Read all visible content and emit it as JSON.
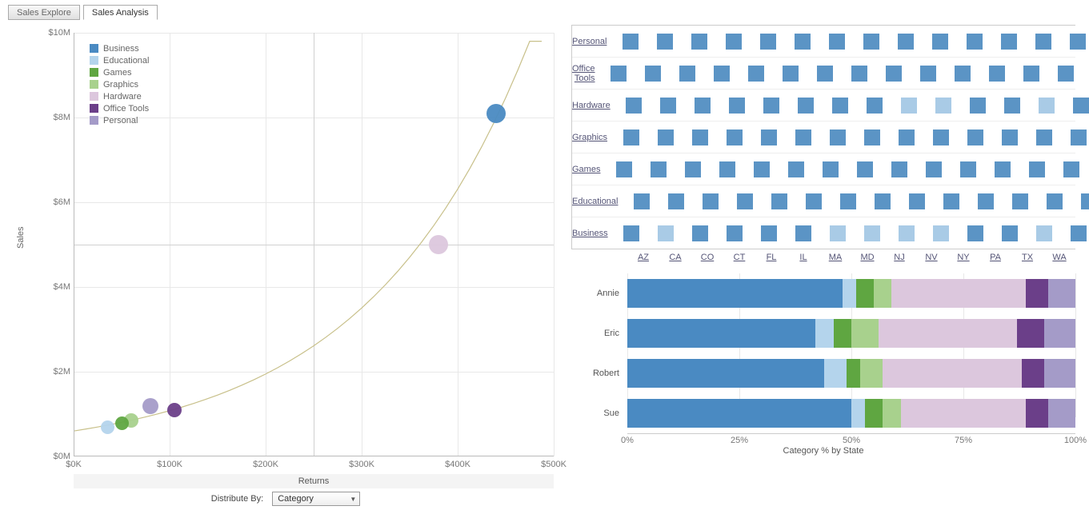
{
  "tabs": {
    "explore": "Sales Explore",
    "analysis": "Sales Analysis"
  },
  "legend": [
    {
      "label": "Business",
      "color": "#4a8ac2"
    },
    {
      "label": "Educational",
      "color": "#b4d4ec"
    },
    {
      "label": "Games",
      "color": "#5fa641"
    },
    {
      "label": "Graphics",
      "color": "#a8d18d"
    },
    {
      "label": "Hardware",
      "color": "#dcc7dd"
    },
    {
      "label": "Office Tools",
      "color": "#6b3f89"
    },
    {
      "label": "Personal",
      "color": "#a49bc8"
    }
  ],
  "chart_data": [
    {
      "type": "scatter",
      "title": "",
      "xlabel": "Returns",
      "ylabel": "Sales",
      "xlim": [
        0,
        500000
      ],
      "ylim": [
        0,
        10000000
      ],
      "x_ticks": [
        "$0K",
        "$100K",
        "$200K",
        "$300K",
        "$400K",
        "$500K"
      ],
      "y_ticks": [
        "$0M",
        "$2M",
        "$4M",
        "$6M",
        "$8M",
        "$10M"
      ],
      "reference_x": 250000,
      "reference_y": 5000000,
      "series": [
        {
          "name": "Business",
          "x": 440000,
          "y": 8100000,
          "size": 24,
          "color": "#4a8ac2"
        },
        {
          "name": "Hardware",
          "x": 380000,
          "y": 5000000,
          "size": 24,
          "color": "#dcc7dd"
        },
        {
          "name": "Office Tools",
          "x": 105000,
          "y": 1100000,
          "size": 18,
          "color": "#6b3f89"
        },
        {
          "name": "Personal",
          "x": 80000,
          "y": 1180000,
          "size": 20,
          "color": "#a49bc8"
        },
        {
          "name": "Graphics",
          "x": 60000,
          "y": 850000,
          "size": 18,
          "color": "#a8d18d"
        },
        {
          "name": "Games",
          "x": 50000,
          "y": 780000,
          "size": 17,
          "color": "#5fa641"
        },
        {
          "name": "Educational",
          "x": 35000,
          "y": 680000,
          "size": 17,
          "color": "#b4d4ec"
        }
      ],
      "trend": "exponential"
    },
    {
      "type": "heatmap",
      "rows": [
        "Personal",
        "Office Tools",
        "Hardware",
        "Graphics",
        "Games",
        "Educational",
        "Business"
      ],
      "cols": [
        "AZ",
        "CA",
        "CO",
        "CT",
        "FL",
        "IL",
        "MA",
        "MD",
        "NJ",
        "NV",
        "NY",
        "PA",
        "TX",
        "WA"
      ],
      "shade": {
        "default": "#5b94c5",
        "light": "#a9cbe6",
        "overrides": {
          "Hardware": {
            "NJ": "light",
            "NV": "light",
            "TX": "light"
          },
          "Business": {
            "CA": "light",
            "MA": "light",
            "MD": "light",
            "NJ": "light",
            "NV": "light",
            "TX": "light"
          }
        }
      }
    },
    {
      "type": "bar",
      "orientation": "horizontal-stacked",
      "title": "Category % by State",
      "xlabel": "",
      "ylabel": "",
      "xlim": [
        0,
        100
      ],
      "x_ticks": [
        "0%",
        "25%",
        "50%",
        "75%",
        "100%"
      ],
      "categories": [
        "Annie",
        "Eric",
        "Robert",
        "Sue"
      ],
      "stack_order": [
        "Business",
        "Educational",
        "Games",
        "Graphics",
        "Hardware",
        "Office Tools",
        "Personal"
      ],
      "series": [
        {
          "name": "Business",
          "values": [
            48,
            42,
            44,
            50
          ],
          "color": "#4a8ac2"
        },
        {
          "name": "Educational",
          "values": [
            3,
            4,
            5,
            3
          ],
          "color": "#b4d4ec"
        },
        {
          "name": "Games",
          "values": [
            4,
            4,
            3,
            4
          ],
          "color": "#5fa641"
        },
        {
          "name": "Graphics",
          "values": [
            4,
            6,
            5,
            4
          ],
          "color": "#a8d18d"
        },
        {
          "name": "Hardware",
          "values": [
            30,
            31,
            31,
            28
          ],
          "color": "#dcc7dd"
        },
        {
          "name": "Office Tools",
          "values": [
            5,
            6,
            5,
            5
          ],
          "color": "#6b3f89"
        },
        {
          "name": "Personal",
          "values": [
            6,
            7,
            7,
            6
          ],
          "color": "#a49bc8"
        }
      ]
    }
  ],
  "distribute": {
    "label": "Distribute By:",
    "value": "Category"
  }
}
